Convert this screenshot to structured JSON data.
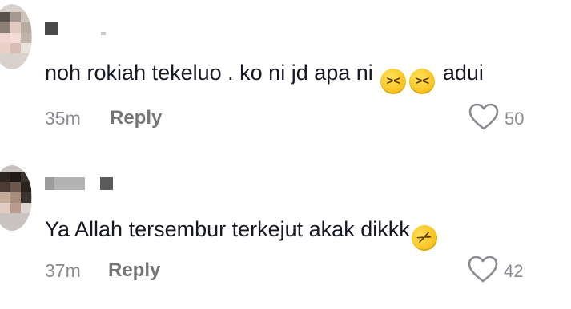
{
  "comments": [
    {
      "text": "noh rokiah tekeluo . ko ni jd apa ni",
      "text_suffix": "adui",
      "emojis": [
        "grinning-squinting-face",
        "grinning-squinting-face"
      ],
      "time": "35m",
      "reply_label": "Reply",
      "likes": "50"
    },
    {
      "text": "Ya Allah tersembur terkejut akak dikkk",
      "emojis": [
        "rolling-on-floor-laughing"
      ],
      "time": "37m",
      "reply_label": "Reply",
      "likes": "42"
    }
  ],
  "colors": {
    "text": "#161823",
    "muted": "#8a8b91",
    "reply": "#757575",
    "emoji": "#f5b400"
  }
}
